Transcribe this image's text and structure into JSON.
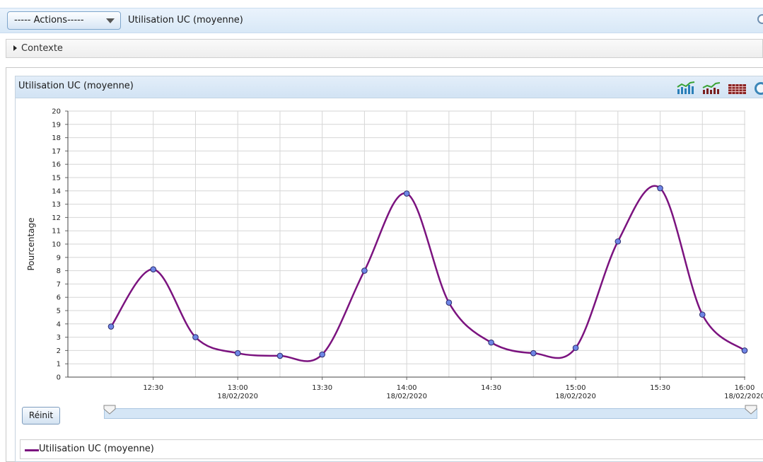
{
  "toolbar": {
    "actions_label": "----- Actions-----",
    "title": "Utilisation UC (moyenne)"
  },
  "context": {
    "label": "Contexte"
  },
  "panel": {
    "title": "Utilisation UC (moyenne)"
  },
  "controls": {
    "reset_label": "Réinit"
  },
  "icons": [
    "bar-chart-icon",
    "line-chart-icon",
    "table-view-icon",
    "sql-icon"
  ],
  "colors": {
    "series": "#7b137f",
    "marker": "#6f86e6",
    "header_bg": "#d8e8f7"
  },
  "chart_data": {
    "type": "line",
    "ylabel": "Pourcentage",
    "ylim": [
      0,
      20
    ],
    "yticks": [
      0,
      1,
      2,
      3,
      4,
      5,
      6,
      7,
      8,
      9,
      10,
      11,
      12,
      13,
      14,
      15,
      16,
      17,
      18,
      19,
      20
    ],
    "xlim": [
      "12:15",
      "16:00"
    ],
    "x_ticks": [
      {
        "value": "12:30",
        "time": "12:30",
        "date": ""
      },
      {
        "value": "13:00",
        "time": "13:00",
        "date": "18/02/2020"
      },
      {
        "value": "13:30",
        "time": "13:30",
        "date": ""
      },
      {
        "value": "14:00",
        "time": "14:00",
        "date": "18/02/2020"
      },
      {
        "value": "14:30",
        "time": "14:30",
        "date": ""
      },
      {
        "value": "15:00",
        "time": "15:00",
        "date": "18/02/2020"
      },
      {
        "value": "15:30",
        "time": "15:30",
        "date": ""
      },
      {
        "value": "16:00",
        "time": "16:00",
        "date": "18/02/2020"
      }
    ],
    "series": [
      {
        "name": "Utilisation UC (moyenne)",
        "x": [
          "12:15",
          "12:30",
          "12:45",
          "13:00",
          "13:15",
          "13:30",
          "13:45",
          "14:00",
          "14:15",
          "14:30",
          "14:45",
          "15:00",
          "15:15",
          "15:30",
          "15:45",
          "16:00"
        ],
        "y": [
          3.8,
          8.1,
          3.0,
          1.8,
          1.6,
          1.7,
          8.0,
          13.8,
          5.6,
          2.6,
          1.8,
          2.2,
          10.2,
          14.2,
          4.7,
          2.0
        ]
      }
    ],
    "grid": true,
    "legend_position": "bottom-left"
  }
}
